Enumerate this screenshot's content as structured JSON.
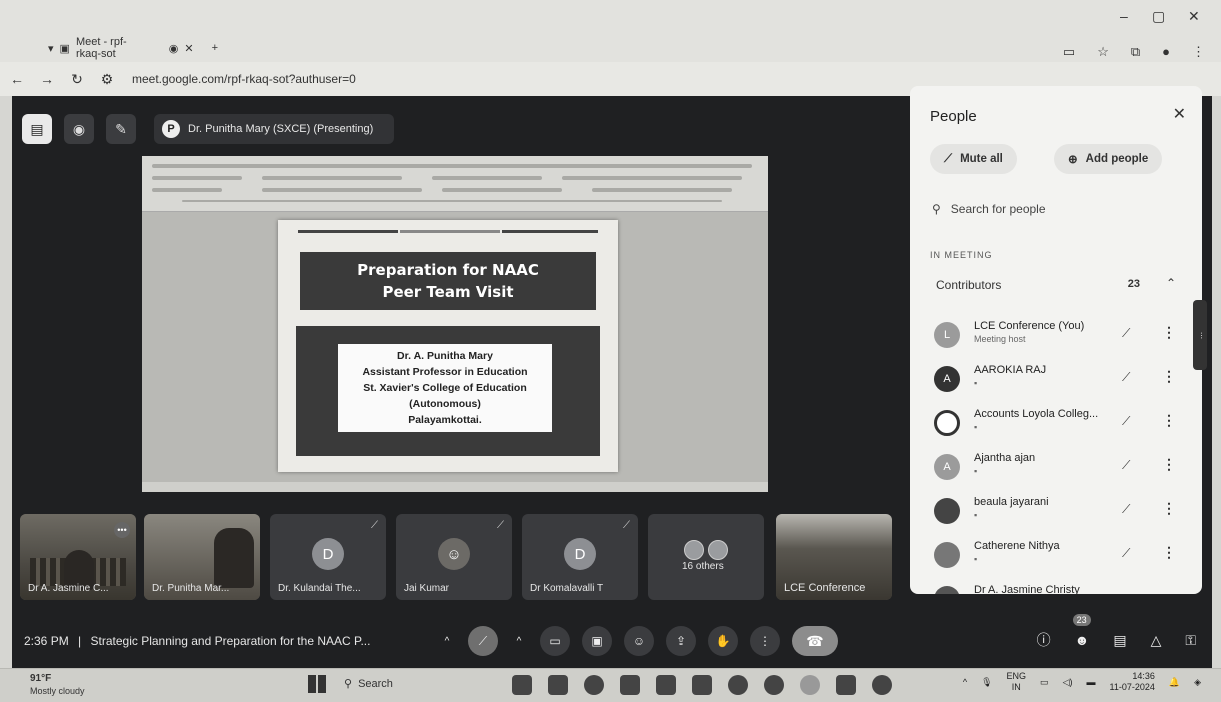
{
  "browser": {
    "tab_title": "Meet - rpf-rkaq-sot",
    "url": "meet.google.com/rpf-rkaq-sot?authuser=0",
    "window_controls": [
      "–",
      "▢",
      "✕"
    ]
  },
  "meet": {
    "presenter_label": "Dr. Punitha Mary (SXCE) (Presenting)",
    "slide": {
      "title_line1": "Preparation for NAAC",
      "title_line2": "Peer Team Visit",
      "author_lines": [
        "Dr. A. Punitha Mary",
        "Assistant Professor in Education",
        "St. Xavier's College of Education",
        "(Autonomous)",
        "Palayamkottai."
      ]
    },
    "tiles": [
      {
        "name": "Dr A. Jasmine C..."
      },
      {
        "name": "Dr. Punitha Mar..."
      },
      {
        "name": "Dr. Kulandai The...",
        "initial": "D"
      },
      {
        "name": "Jai Kumar"
      },
      {
        "name": "Dr Komalavalli T",
        "initial": "D"
      },
      {
        "name": "16 others"
      },
      {
        "name": "LCE Conference"
      }
    ],
    "time": "2:36 PM",
    "meeting_title": "Strategic Planning and Preparation for the NAAC P...",
    "participants_count": "23"
  },
  "people_panel": {
    "title": "People",
    "mute_all": "Mute all",
    "add_people": "Add people",
    "search_placeholder": "Search for people",
    "section": "IN MEETING",
    "group": "Contributors",
    "group_count": "23",
    "people": [
      {
        "name": "LCE Conference (You)",
        "sub": "Meeting host",
        "initial": "L"
      },
      {
        "name": "AAROKIA RAJ",
        "sub": "▪",
        "initial": "A"
      },
      {
        "name": "Accounts Loyola Colleg...",
        "sub": "▪",
        "initial": ""
      },
      {
        "name": "Ajantha ajan",
        "sub": "▪",
        "initial": "A"
      },
      {
        "name": "beaula jayarani",
        "sub": "▪",
        "initial": ""
      },
      {
        "name": "Catherene Nithya",
        "sub": "▪",
        "initial": ""
      },
      {
        "name": "Dr A. Jasmine Christy",
        "sub": "",
        "initial": ""
      }
    ]
  },
  "taskbar": {
    "temperature": "91°F",
    "weather": "Mostly cloudy",
    "search": "Search",
    "lang_top": "ENG",
    "lang_bottom": "IN",
    "clock_time": "14:36",
    "clock_date": "11-07-2024"
  }
}
